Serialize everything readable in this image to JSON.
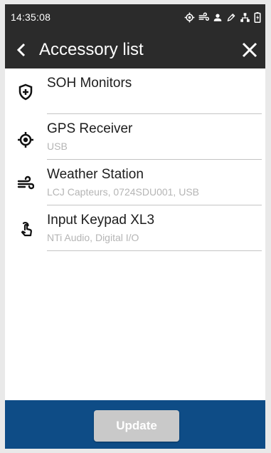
{
  "status_bar": {
    "time": "14:35:08",
    "icons": [
      "gps-fix-icon",
      "wind-icon",
      "person-icon",
      "pen-icon",
      "network-icon",
      "battery-charging-icon"
    ]
  },
  "app_bar": {
    "title": "Accessory list",
    "back_icon": "chevron-left-icon",
    "close_icon": "close-icon"
  },
  "accessories": [
    {
      "icon": "shield-plus-icon",
      "title": "SOH Monitors",
      "subtitle": ""
    },
    {
      "icon": "gps-target-icon",
      "title": "GPS Receiver",
      "subtitle": "USB"
    },
    {
      "icon": "wind-icon",
      "title": "Weather Station",
      "subtitle": "LCJ Capteurs, 0724SDU001, USB"
    },
    {
      "icon": "touch-hand-icon",
      "title": "Input Keypad XL3",
      "subtitle": "NTi Audio, Digital I/O"
    }
  ],
  "footer": {
    "update_label": "Update"
  },
  "colors": {
    "bar_background": "#2b2b2b",
    "footer_background": "#0e4c86",
    "button_disabled": "#c9c9c9",
    "subtitle_text": "#b5b5b5"
  }
}
